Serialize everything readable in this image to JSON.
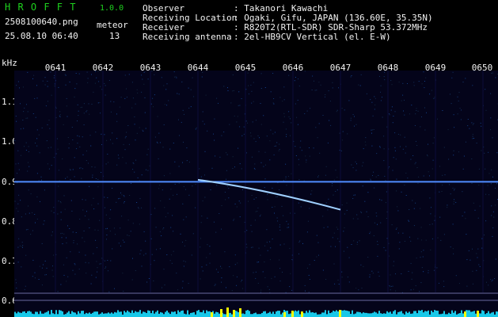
{
  "header": {
    "app_title": "H R O F F T",
    "version": "1.0.0",
    "filename": "2508100640.png",
    "timestamp": "25.08.10 06:40",
    "meteor_label": "meteor",
    "meteor_count": "13",
    "observer_label": "Observer",
    "observer_value": ": Takanori Kawachi",
    "location_label": "Receiving Location",
    "location_value": ": Ogaki, Gifu, JAPAN (136.60E, 35.35N)",
    "receiver_label": "Receiver",
    "receiver_value": ": R820T2(RTL-SDR) SDR-Sharp 53.372MHz",
    "antenna_label": "Receiving antenna",
    "antenna_value": ": 2el-HB9CV Vertical (el. E-W)"
  },
  "axes": {
    "y_unit": "kHz",
    "x_ticks": [
      "0641",
      "0642",
      "0643",
      "0644",
      "0645",
      "0646",
      "0647",
      "0648",
      "0649",
      "0650"
    ],
    "y_ticks": [
      "1.1",
      "1.0",
      "0.9",
      "0.8",
      "0.7",
      "0.6"
    ]
  },
  "colors": {
    "background": "#04041a",
    "carrier": "#4f8cff",
    "meteor": "#9fd0ff",
    "header_green": "#1ed11e",
    "marker_yellow": "#ffff00",
    "spectrum_cyan": "#18c8e8"
  },
  "signals": {
    "carrier_khz": 0.9,
    "meteor_start_minute": 6.44,
    "meteor_start_khz": 0.905,
    "meteor_end_minute": 6.47,
    "meteor_end_khz": 0.83
  }
}
